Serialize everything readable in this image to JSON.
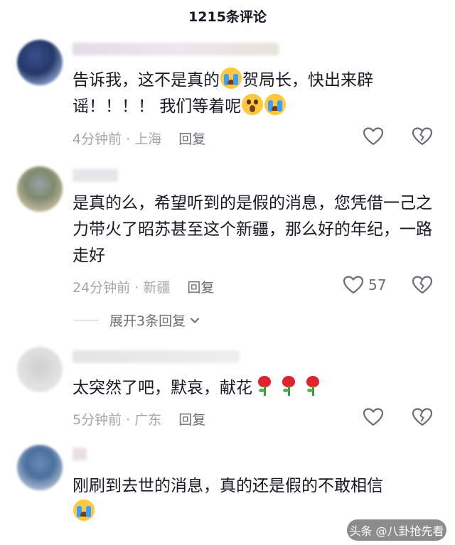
{
  "header": {
    "title": "1215条评论"
  },
  "comments": [
    {
      "text": "告诉我，这不是真的",
      "text_parts": [
        "告诉我，这不是真的",
        "贺局长，快出来辟谣！！！！ 我们等着呢"
      ],
      "time": "4分钟前",
      "location": "上海",
      "reply": "回复",
      "likes": ""
    },
    {
      "text": "是真的么，希望听到的是假的消息，您凭借一己之力带火了昭苏甚至这个新疆，那么好的年纪，一路走好",
      "time": "24分钟前",
      "location": "新疆",
      "reply": "回复",
      "likes": "57",
      "expand": "展开3条回复"
    },
    {
      "text": "太突然了吧，默哀，献花",
      "time": "5分钟前",
      "location": "广东",
      "reply": "回复",
      "likes": ""
    },
    {
      "text": "刚刷到去世的消息，真的还是假的不敢相信",
      "time": "",
      "location": "",
      "reply": "",
      "likes": ""
    }
  ],
  "separator": "·",
  "watermark": "头条 @八卦抢先看",
  "icons": {
    "like": "heart-outline-icon",
    "dislike": "broken-heart-icon",
    "expand": "chevron-down-icon",
    "emoji_cry": "crying-face-emoji",
    "emoji_shock": "shocked-face-emoji",
    "flower": "rose-emoji"
  },
  "colors": {
    "text": "#161823",
    "meta": "#a3a4ad",
    "reply": "#6b6d76",
    "emoji": "#ffc83d",
    "rose": "#e0242e"
  }
}
